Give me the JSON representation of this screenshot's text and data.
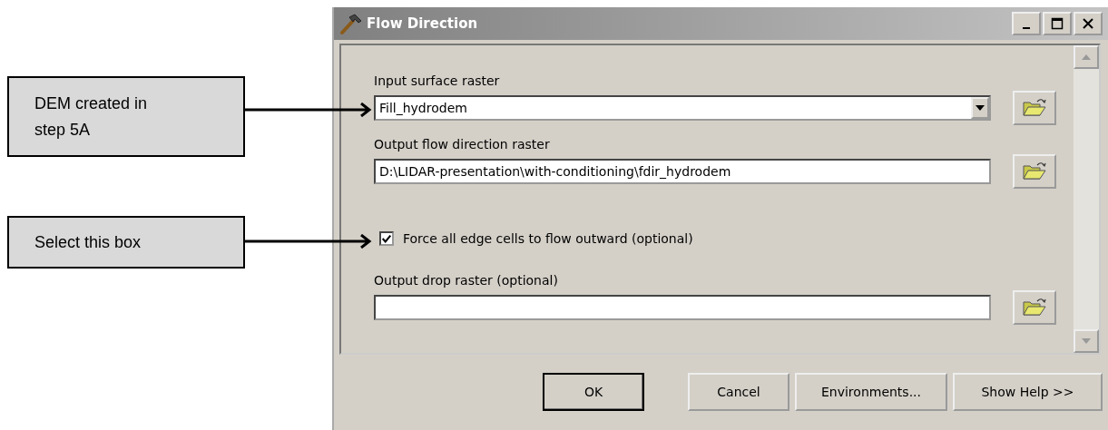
{
  "annotations": [
    {
      "text": "DEM created in step 5A"
    },
    {
      "text": "Select this box"
    }
  ],
  "window": {
    "title": "Flow Direction"
  },
  "parameters": [
    {
      "kind": "dropdown",
      "label": "Input surface raster",
      "value": "Fill_hydrodem"
    },
    {
      "kind": "path",
      "label": "Output flow direction raster",
      "value": "D:\\LIDAR-presentation\\with-conditioning\\fdir_hydrodem"
    },
    {
      "kind": "checkbox",
      "label": "Force all edge cells to flow outward (optional)",
      "checked": true
    },
    {
      "kind": "path",
      "label": "Output drop raster (optional)"
    }
  ],
  "buttons": [
    {
      "label": "OK",
      "default": true
    },
    {
      "label": "Cancel",
      "default": false
    },
    {
      "label": "Environments...",
      "default": false
    },
    {
      "label": "Show Help >>",
      "default": false
    }
  ]
}
